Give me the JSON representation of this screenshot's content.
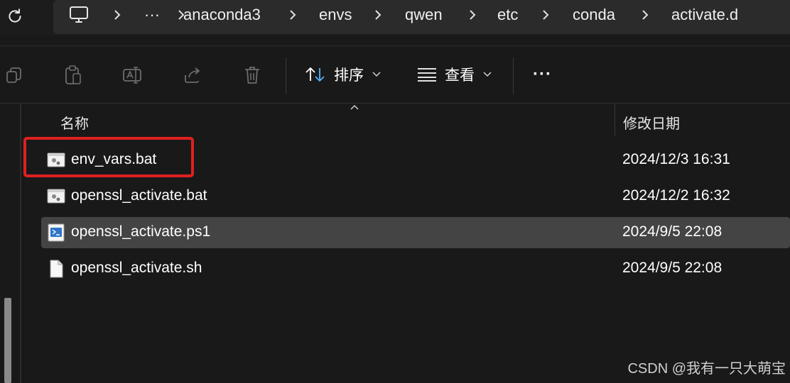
{
  "breadcrumbs": {
    "more": "···",
    "items": [
      "anaconda3",
      "envs",
      "qwen",
      "etc",
      "conda",
      "activate.d"
    ]
  },
  "toolbar": {
    "sort_label": "排序",
    "view_label": "查看",
    "more_label": "···"
  },
  "columns": {
    "name": "名称",
    "modified": "修改日期"
  },
  "files": [
    {
      "name": "env_vars.bat",
      "date": "2024/12/3 16:31",
      "icon": "batch-file-icon",
      "highlighted": true
    },
    {
      "name": "openssl_activate.bat",
      "date": "2024/12/2 16:32",
      "icon": "batch-file-icon"
    },
    {
      "name": "openssl_activate.ps1",
      "date": "2024/9/5 22:08",
      "icon": "powershell-file-icon",
      "selected": true
    },
    {
      "name": "openssl_activate.sh",
      "date": "2024/9/5 22:08",
      "icon": "blank-file-icon"
    }
  ],
  "watermark": "CSDN @我有一只大萌宝",
  "colors": {
    "background": "#191919",
    "selected_row": "#444444",
    "highlight": "#e02020"
  }
}
